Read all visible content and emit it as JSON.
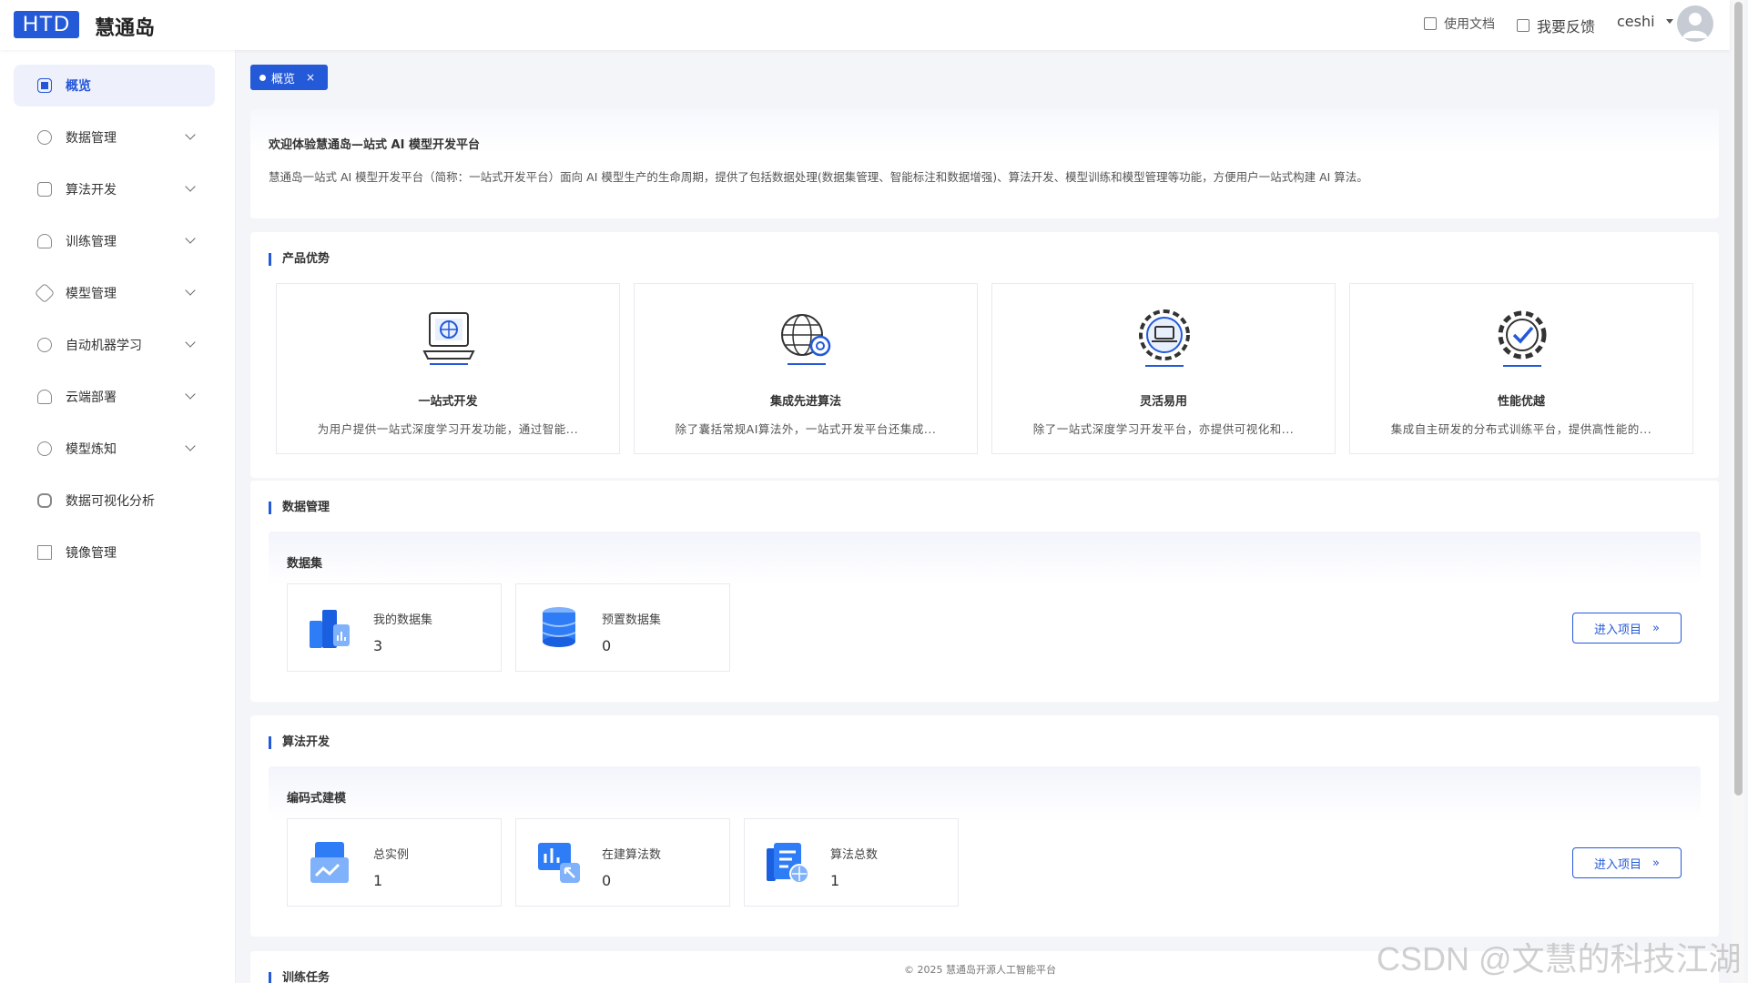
{
  "header": {
    "logo": "HTD",
    "brand": "慧通岛",
    "doc_link": "使用文档",
    "feedback_link": "我要反馈",
    "username": "ceshi"
  },
  "sidebar": {
    "items": [
      {
        "label": "概览",
        "icon": "overview-icon",
        "active": true,
        "has_children": false
      },
      {
        "label": "数据管理",
        "icon": "data-icon",
        "active": false,
        "has_children": true
      },
      {
        "label": "算法开发",
        "icon": "algorithm-icon",
        "active": false,
        "has_children": true
      },
      {
        "label": "训练管理",
        "icon": "training-icon",
        "active": false,
        "has_children": true
      },
      {
        "label": "模型管理",
        "icon": "model-icon",
        "active": false,
        "has_children": true
      },
      {
        "label": "自动机器学习",
        "icon": "automl-icon",
        "active": false,
        "has_children": true
      },
      {
        "label": "云端部署",
        "icon": "cloud-icon",
        "active": false,
        "has_children": true
      },
      {
        "label": "模型炼知",
        "icon": "knowledge-icon",
        "active": false,
        "has_children": true
      },
      {
        "label": "数据可视化分析",
        "icon": "visualize-icon",
        "active": false,
        "has_children": false
      },
      {
        "label": "镜像管理",
        "icon": "image-icon",
        "active": false,
        "has_children": false
      }
    ]
  },
  "tab": {
    "label": "概览",
    "close": "×"
  },
  "welcome": {
    "title": "欢迎体验慧通岛—站式 AI 模型开发平台",
    "description": "慧通岛一站式 AI 模型开发平台（简称：一站式开发平台）面向 AI 模型生产的生命周期，提供了包括数据处理(数据集管理、智能标注和数据增强)、算法开发、模型训练和模型管理等功能，方便用户一站式构建 AI 算法。"
  },
  "advantages": {
    "title": "产品优势",
    "items": [
      {
        "title": "一站式开发",
        "desc": "为用户提供一站式深度学习开发功能，通过智能...",
        "icon": "laptop-globe-icon"
      },
      {
        "title": "集成先进算法",
        "desc": "除了囊括常规AI算法外，一站式开发平台还集成...",
        "icon": "globe-gear-icon"
      },
      {
        "title": "灵活易用",
        "desc": "除了一站式深度学习开发平台，亦提供可视化和...",
        "icon": "gear-laptop-icon"
      },
      {
        "title": "性能优越",
        "desc": "集成自主研发的分布式训练平台，提供高性能的...",
        "icon": "gear-check-icon"
      }
    ]
  },
  "data_mgmt": {
    "title": "数据管理",
    "sub_title": "数据集",
    "stats": [
      {
        "label": "我的数据集",
        "value": "3",
        "icon": "my-dataset-icon"
      },
      {
        "label": "预置数据集",
        "value": "0",
        "icon": "preset-dataset-icon"
      }
    ],
    "enter": "进入项目"
  },
  "algo_dev": {
    "title": "算法开发",
    "sub_title": "编码式建模",
    "stats": [
      {
        "label": "总实例",
        "value": "1",
        "icon": "instance-icon"
      },
      {
        "label": "在建算法数",
        "value": "0",
        "icon": "building-algo-icon"
      },
      {
        "label": "算法总数",
        "value": "1",
        "icon": "total-algo-icon"
      }
    ],
    "enter": "进入项目"
  },
  "training": {
    "title": "训练任务"
  },
  "footer": "© 2025 慧通岛开源人工智能平台",
  "watermark": "CSDN @文慧的科技江湖",
  "colors": {
    "primary": "#2459d8",
    "background": "#f4f5f8"
  }
}
